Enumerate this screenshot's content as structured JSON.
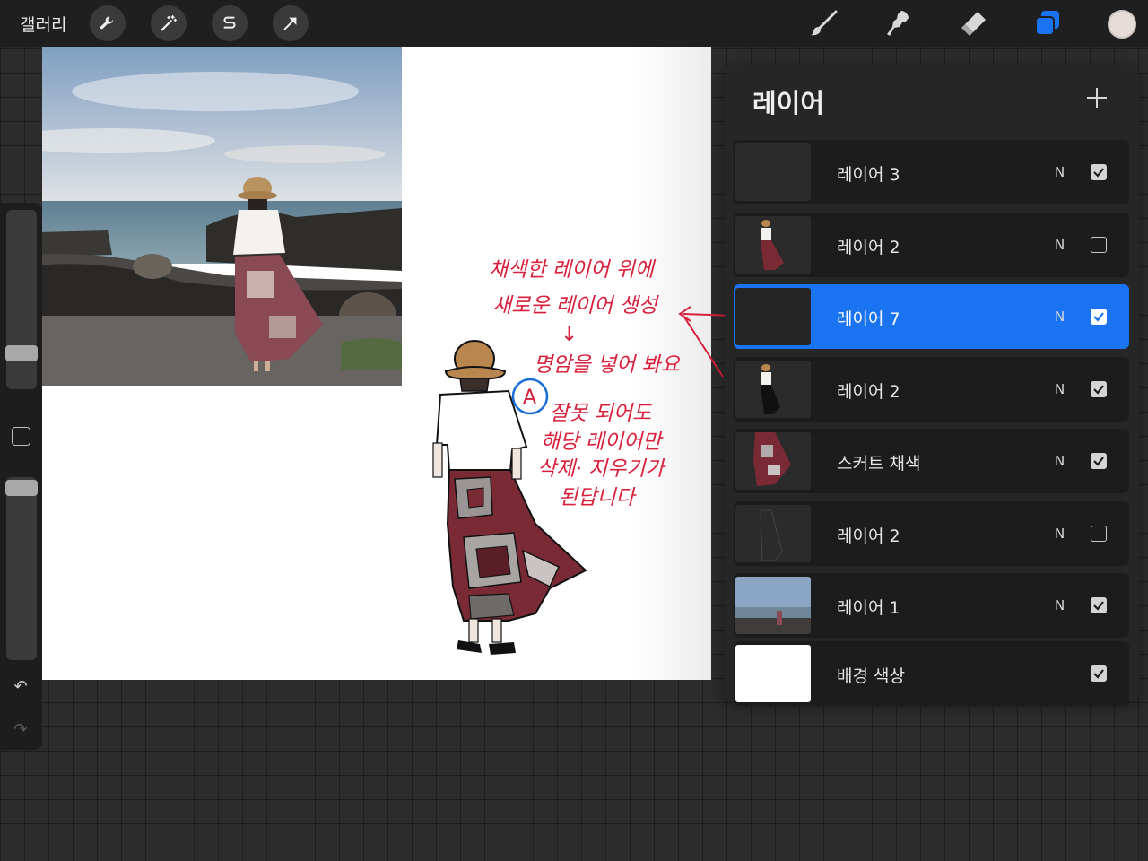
{
  "topbar": {
    "gallery_label": "갤러리",
    "left_tools": [
      "wrench-icon",
      "magic-wand-icon",
      "selection-s-icon",
      "arrow-move-icon"
    ],
    "right_tools": [
      "brush-icon",
      "smudge-icon",
      "eraser-icon",
      "layers-icon"
    ],
    "active_tool": "layers-icon",
    "active_color": "#e5dcd7",
    "accent_color": "#1a73f0"
  },
  "annotation": {
    "lines": [
      "채색한 레이어 위에",
      "새로운 레이어 생성",
      "↓",
      "명암을 넣어 봐요",
      "잘못 되어도",
      "해당 레이어만",
      "삭제· 지우기가",
      "된답니다"
    ],
    "marker": "A",
    "color": "#d8203c"
  },
  "layers_panel": {
    "title": "레이어",
    "add_icon": "plus-icon",
    "layers": [
      {
        "name": "레이어 3",
        "blend": "N",
        "visible": true,
        "selected": false,
        "thumb": "empty"
      },
      {
        "name": "레이어 2",
        "blend": "N",
        "visible": false,
        "selected": false,
        "thumb": "figure-color"
      },
      {
        "name": "레이어 7",
        "blend": "N",
        "visible": true,
        "selected": true,
        "thumb": "empty"
      },
      {
        "name": "레이어 2",
        "blend": "N",
        "visible": true,
        "selected": false,
        "thumb": "figure-line"
      },
      {
        "name": "스커트 채색",
        "blend": "N",
        "visible": true,
        "selected": false,
        "thumb": "skirt"
      },
      {
        "name": "레이어 2",
        "blend": "N",
        "visible": false,
        "selected": false,
        "thumb": "figure-faint"
      },
      {
        "name": "레이어 1",
        "blend": "N",
        "visible": true,
        "selected": false,
        "thumb": "photo"
      },
      {
        "name": "배경 색상",
        "blend": "",
        "visible": true,
        "selected": false,
        "thumb": "white"
      }
    ]
  },
  "sidebar": {
    "brush_size_level": 0.78,
    "opacity_level": 0.95,
    "undo_icon": "undo-icon",
    "redo_icon": "redo-icon",
    "modifier_icon": "square-modifier-icon"
  }
}
